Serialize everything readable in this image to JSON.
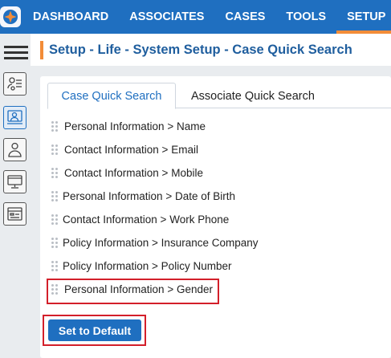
{
  "topbar": {
    "logo_icon": "star-logo-icon",
    "nav": [
      {
        "label": "DASHBOARD",
        "active": false
      },
      {
        "label": "ASSOCIATES",
        "active": false
      },
      {
        "label": "CASES",
        "active": false
      },
      {
        "label": "TOOLS",
        "active": false
      },
      {
        "label": "SETUP",
        "active": true
      }
    ],
    "colors": {
      "bar": "#1f6fc0",
      "active_underline": "#f28c38"
    }
  },
  "sidebar": {
    "menu_icon": "hamburger-menu-icon",
    "items": [
      {
        "icon": "user-settings-icon",
        "active": false
      },
      {
        "icon": "monitor-user-icon",
        "active": true
      },
      {
        "icon": "person-icon",
        "active": false
      },
      {
        "icon": "computer-icon",
        "active": false
      },
      {
        "icon": "browser-window-icon",
        "active": false
      }
    ]
  },
  "page": {
    "title": "Setup - Life - System Setup - Case Quick Search"
  },
  "tabs": [
    {
      "label": "Case Quick Search",
      "active": true
    },
    {
      "label": "Associate Quick Search",
      "active": false
    }
  ],
  "fields": [
    {
      "label": "Personal Information > Name"
    },
    {
      "label": "Contact Information > Email"
    },
    {
      "label": "Contact Information > Mobile"
    },
    {
      "label": "Personal Information > Date of Birth"
    },
    {
      "label": "Contact Information > Work Phone"
    },
    {
      "label": "Policy Information > Insurance Company"
    },
    {
      "label": "Policy Information > Policy Number"
    },
    {
      "label": "Personal Information > Gender",
      "highlighted": true
    }
  ],
  "actions": {
    "default_label": "Set to Default"
  }
}
